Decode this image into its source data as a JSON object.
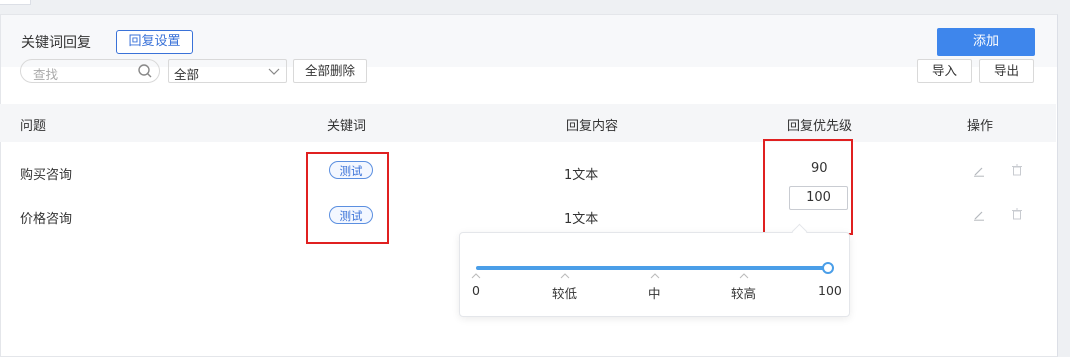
{
  "header": {
    "title": "关键词回复",
    "reply_settings_label": "回复设置",
    "add_label": "添加"
  },
  "toolbar": {
    "search_placeholder": "查找",
    "filter_value": "全部",
    "delete_all_label": "全部删除",
    "import_label": "导入",
    "export_label": "导出"
  },
  "table": {
    "columns": [
      "问题",
      "关键词",
      "回复内容",
      "回复优先级",
      "操作"
    ],
    "rows": [
      {
        "question": "购买咨询",
        "keyword": "测试",
        "content": "1文本",
        "priority": "90"
      },
      {
        "question": "价格咨询",
        "keyword": "测试",
        "content": "1文本",
        "priority": "100"
      }
    ]
  },
  "priority_slider": {
    "value": 100,
    "min": 0,
    "max": 100,
    "labels": [
      "0",
      "较低",
      "中",
      "较高",
      "100"
    ]
  },
  "colors": {
    "accent": "#3e86ec",
    "highlight": "#e02020"
  }
}
